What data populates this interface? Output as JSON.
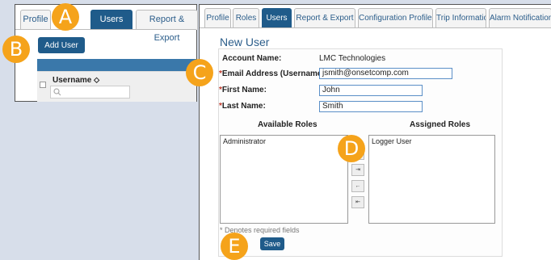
{
  "left": {
    "tabs": [
      "Profile",
      "Users",
      "Report & Export"
    ],
    "add_user_label": "Add User",
    "username_header": "Username ⬦"
  },
  "right": {
    "tabs": [
      "Profile",
      "Roles",
      "Users",
      "Report & Export",
      "Configuration Profiles",
      "Trip Information",
      "Alarm Notifications"
    ],
    "title": "New User",
    "account_name_label": "Account Name:",
    "account_name_value": "LMC Technologies",
    "email_label": "Email Address (Username):",
    "email_value": "jsmith@onsetcomp.com",
    "first_name_label": "First Name:",
    "first_name_value": "John",
    "last_name_label": "Last Name:",
    "last_name_value": "Smith",
    "available_roles_header": "Available Roles",
    "assigned_roles_header": "Assigned Roles",
    "available_roles": [
      "Administrator"
    ],
    "assigned_roles": [
      "Logger User"
    ],
    "move_buttons": [
      "→",
      "⇥",
      "←",
      "⇤"
    ],
    "required_note": "* Denotes required fields",
    "save_label": "Save",
    "required_mark": "*"
  },
  "markers": [
    "A",
    "B",
    "C",
    "D",
    "E"
  ],
  "colors": {
    "accent": "#1f5b8a",
    "marker": "#f5a31b",
    "link": "#2b5d8a"
  }
}
